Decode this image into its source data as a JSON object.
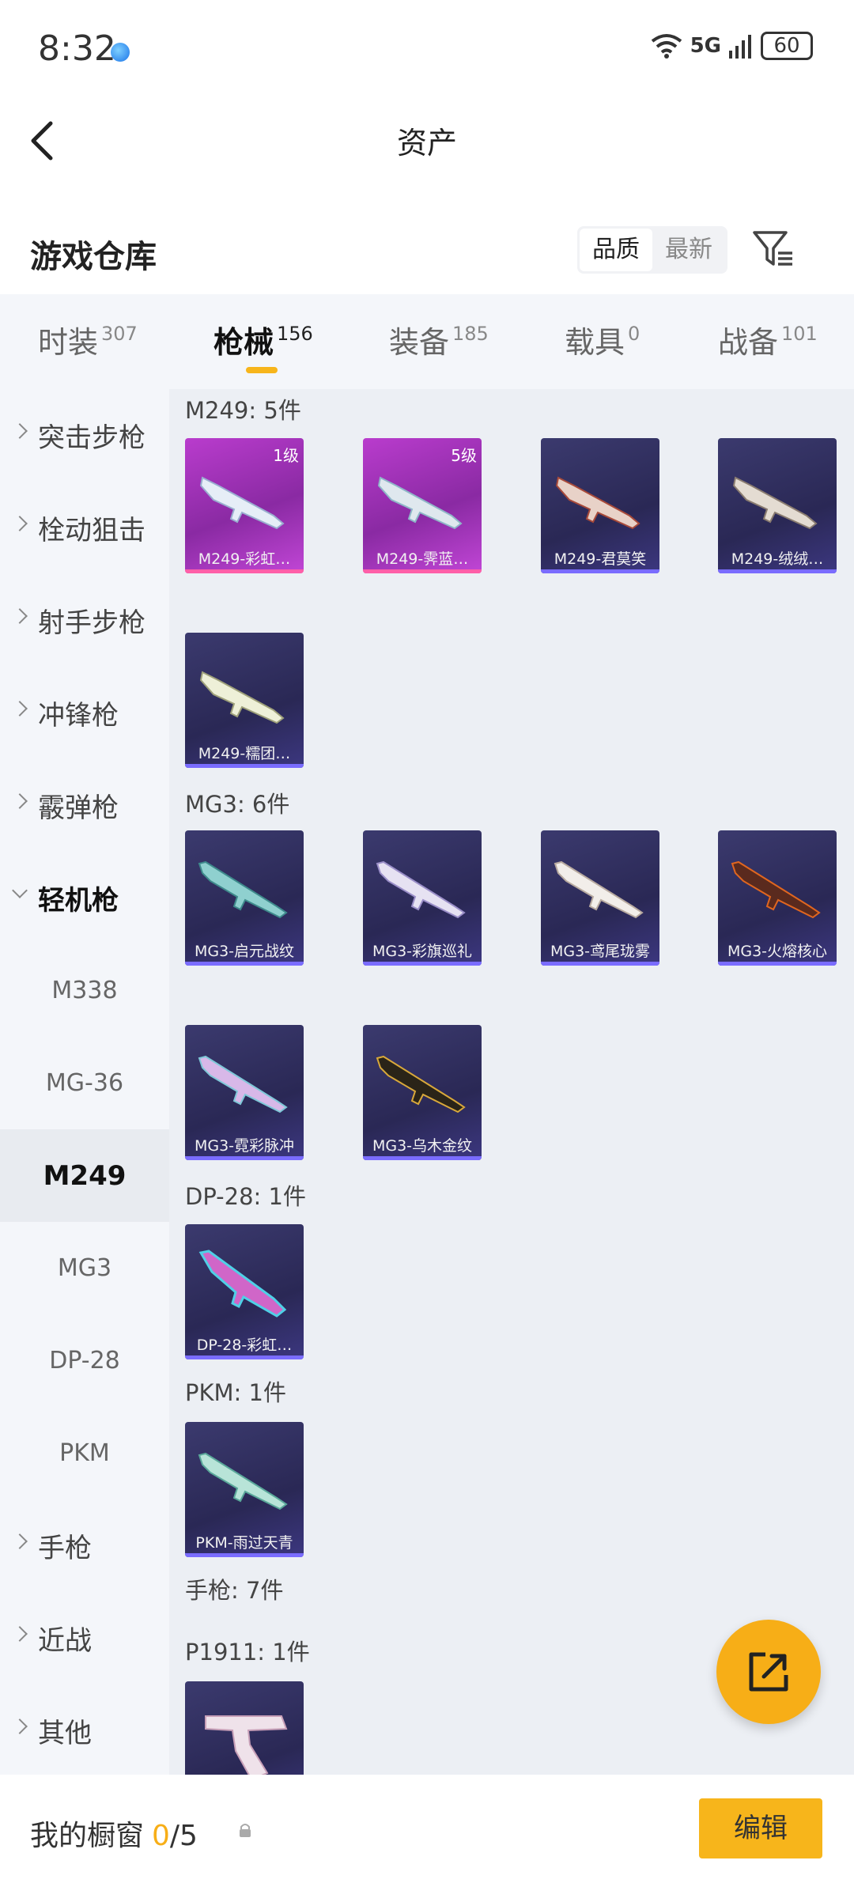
{
  "status_bar": {
    "time": "8:32",
    "network": "5G",
    "battery": "60"
  },
  "nav": {
    "title": "资产"
  },
  "header": {
    "title": "游戏仓库",
    "sort_options": [
      "品质",
      "最新"
    ],
    "sort_selected": "品质"
  },
  "tabs": [
    {
      "label": "时装",
      "count": "307"
    },
    {
      "label": "枪械",
      "count": "156"
    },
    {
      "label": "装备",
      "count": "185"
    },
    {
      "label": "载具",
      "count": "0"
    },
    {
      "label": "战备",
      "count": "101"
    }
  ],
  "active_tab": "枪械",
  "sidebar": {
    "categories": [
      "突击步枪",
      "栓动狙击",
      "射手步枪",
      "冲锋枪",
      "霰弹枪",
      "轻机枪",
      "手枪",
      "近战",
      "其他"
    ],
    "expanded": "轻机枪",
    "subitems": [
      "M338",
      "MG-36",
      "M249",
      "MG3",
      "DP-28",
      "PKM"
    ],
    "active_subitem": "M249"
  },
  "groups": [
    {
      "title": "M249: 5件",
      "items": [
        {
          "name": "M249-彩虹…",
          "level": "1级",
          "rarity": "pink"
        },
        {
          "name": "M249-霁蓝…",
          "level": "5级",
          "rarity": "pink"
        },
        {
          "name": "M249-君莫笑",
          "level": "",
          "rarity": "purple"
        },
        {
          "name": "M249-绒绒…",
          "level": "",
          "rarity": "purple"
        },
        {
          "name": "M249-糯团…",
          "level": "",
          "rarity": "purple"
        }
      ]
    },
    {
      "title": "MG3: 6件",
      "items": [
        {
          "name": "MG3-启元战纹",
          "level": "",
          "rarity": "purple"
        },
        {
          "name": "MG3-彩旗巡礼",
          "level": "",
          "rarity": "purple"
        },
        {
          "name": "MG3-鸢尾珑雾",
          "level": "",
          "rarity": "purple"
        },
        {
          "name": "MG3-火熔核心",
          "level": "",
          "rarity": "purple"
        },
        {
          "name": "MG3-霓彩脉冲",
          "level": "",
          "rarity": "purple"
        },
        {
          "name": "MG3-乌木金纹",
          "level": "",
          "rarity": "purple"
        }
      ]
    },
    {
      "title": "DP-28: 1件",
      "items": [
        {
          "name": "DP-28-彩虹…",
          "level": "",
          "rarity": "purple"
        }
      ]
    },
    {
      "title": "PKM: 1件",
      "items": [
        {
          "name": "PKM-雨过天青",
          "level": "",
          "rarity": "purple"
        }
      ]
    }
  ],
  "pistol_header": "手枪: 7件",
  "pistol_group": {
    "title": "P1911: 1件"
  },
  "bottom_bar": {
    "label": "我的橱窗",
    "current": "0",
    "total": "/5",
    "edit_label": "编辑"
  },
  "colors": {
    "accent": "#f7b51b",
    "card_purple": "#2a2855",
    "card_pink": "#b93ccd"
  }
}
